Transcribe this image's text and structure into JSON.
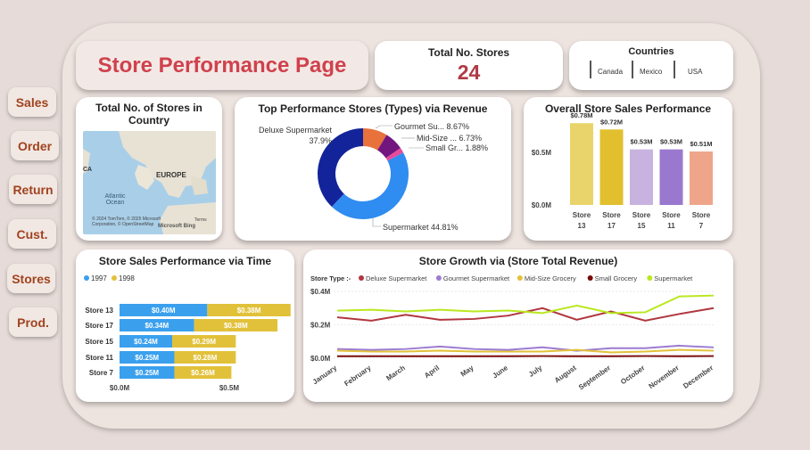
{
  "nav": [
    {
      "label": "Sales"
    },
    {
      "label": "Order"
    },
    {
      "label": "Return"
    },
    {
      "label": "Cust."
    },
    {
      "label": "Stores"
    },
    {
      "label": "Prod."
    }
  ],
  "page_title": "Store Performance Page",
  "kpi": {
    "title": "Total No. Stores",
    "value": "24"
  },
  "countries": {
    "title": "Countries",
    "items": [
      "Canada",
      "Mexico",
      "USA"
    ]
  },
  "map": {
    "title": "Total No. of Stores in Country",
    "labels": {
      "europe": "EUROPE",
      "atlantic": "Atlantic Ocean",
      "edge": "CA",
      "copyright": "© 2024 TomTom, © 2025 Microsoft Corporation, © OpenStreetMap",
      "terms": "Terms"
    },
    "brand": "Microsoft Bing"
  },
  "donut": {
    "title": "Top Performance Stores (Types) via Revenue",
    "slices": [
      {
        "name": "Supermarket",
        "pct": 44.81,
        "label": "Supermarket 44.81%",
        "color": "#2f8cf0"
      },
      {
        "name": "Deluxe Supermarket",
        "pct": 37.9,
        "label_name": "Deluxe Supermarket",
        "label_pct": "37.9%",
        "color": "#13249a"
      },
      {
        "name": "Gourmet Su...",
        "pct": 8.67,
        "label": "Gourmet Su... 8.67%",
        "color": "#e8713c"
      },
      {
        "name": "Mid-Size ...",
        "pct": 6.73,
        "label": "Mid-Size ... 6.73%",
        "color": "#73157f"
      },
      {
        "name": "Small Gr...",
        "pct": 1.88,
        "label": "Small Gr... 1.88%",
        "color": "#e54b9b"
      }
    ]
  },
  "overall": {
    "title": "Overall Store Sales Performance",
    "chart_data": {
      "type": "bar",
      "categories": [
        "Store 13",
        "Store 17",
        "Store 15",
        "Store 11",
        "Store 7"
      ],
      "values": [
        0.78,
        0.72,
        0.53,
        0.53,
        0.51
      ],
      "labels": [
        "$0.78M",
        "$0.72M",
        "$0.53M",
        "$0.53M",
        "$0.51M"
      ],
      "colors": [
        "#e8d46a",
        "#e2bf2e",
        "#c8b3e0",
        "#9a78cf",
        "#eea58a"
      ],
      "yticks": [
        {
          "v": 0,
          "t": "$0.0M"
        },
        {
          "v": 0.5,
          "t": "$0.5M"
        }
      ],
      "ylim": [
        0,
        0.85
      ]
    }
  },
  "time": {
    "title": "Store Sales Performance via Time",
    "chart_data": {
      "type": "bar",
      "categories": [
        "Store 13",
        "Store 17",
        "Store 15",
        "Store 11",
        "Store 7"
      ],
      "series": [
        {
          "name": "1997",
          "color": "#3aa0ee",
          "values": [
            0.4,
            0.34,
            0.24,
            0.25,
            0.25
          ],
          "labels": [
            "$0.40M",
            "$0.34M",
            "$0.24M",
            "$0.25M",
            "$0.25M"
          ]
        },
        {
          "name": "1998",
          "color": "#e2c13a",
          "values": [
            0.38,
            0.38,
            0.29,
            0.28,
            0.26
          ],
          "labels": [
            "$0.38M",
            "$0.38M",
            "$0.29M",
            "$0.28M",
            "$0.26M"
          ]
        }
      ],
      "xticks": [
        {
          "v": 0,
          "t": "$0.0M"
        },
        {
          "v": 0.5,
          "t": "$0.5M"
        }
      ],
      "xlim": [
        0,
        0.85
      ]
    }
  },
  "growth": {
    "title": "Store Growth via (Store Total Revenue)",
    "legend_title": "Store Type :-",
    "chart_data": {
      "type": "line",
      "x": [
        "January",
        "February",
        "March",
        "April",
        "May",
        "June",
        "July",
        "August",
        "September",
        "October",
        "November",
        "December"
      ],
      "series": [
        {
          "name": "Deluxe Supermarket",
          "color": "#b0363f",
          "values": [
            0.245,
            0.225,
            0.26,
            0.23,
            0.235,
            0.255,
            0.3,
            0.23,
            0.28,
            0.225,
            0.265,
            0.3
          ]
        },
        {
          "name": "Gourmet Supermarket",
          "color": "#9d7bd0",
          "values": [
            0.055,
            0.05,
            0.055,
            0.07,
            0.055,
            0.05,
            0.065,
            0.045,
            0.06,
            0.06,
            0.075,
            0.065
          ]
        },
        {
          "name": "Mid-Size Grocery",
          "color": "#e2c13a",
          "values": [
            0.045,
            0.04,
            0.04,
            0.045,
            0.04,
            0.04,
            0.04,
            0.05,
            0.035,
            0.04,
            0.05,
            0.045
          ]
        },
        {
          "name": "Small Grocery",
          "color": "#7a0a0a",
          "values": [
            0.012,
            0.012,
            0.012,
            0.012,
            0.012,
            0.012,
            0.013,
            0.012,
            0.012,
            0.013,
            0.012,
            0.013
          ]
        },
        {
          "name": "Supermarket",
          "color": "#b9e81e",
          "values": [
            0.285,
            0.29,
            0.28,
            0.29,
            0.28,
            0.285,
            0.27,
            0.315,
            0.27,
            0.275,
            0.37,
            0.375
          ]
        }
      ],
      "yticks": [
        {
          "v": 0,
          "t": "$0.0M"
        },
        {
          "v": 0.2,
          "t": "$0.2M"
        },
        {
          "v": 0.4,
          "t": "$0.4M"
        }
      ],
      "ylim": [
        0,
        0.4
      ]
    }
  }
}
